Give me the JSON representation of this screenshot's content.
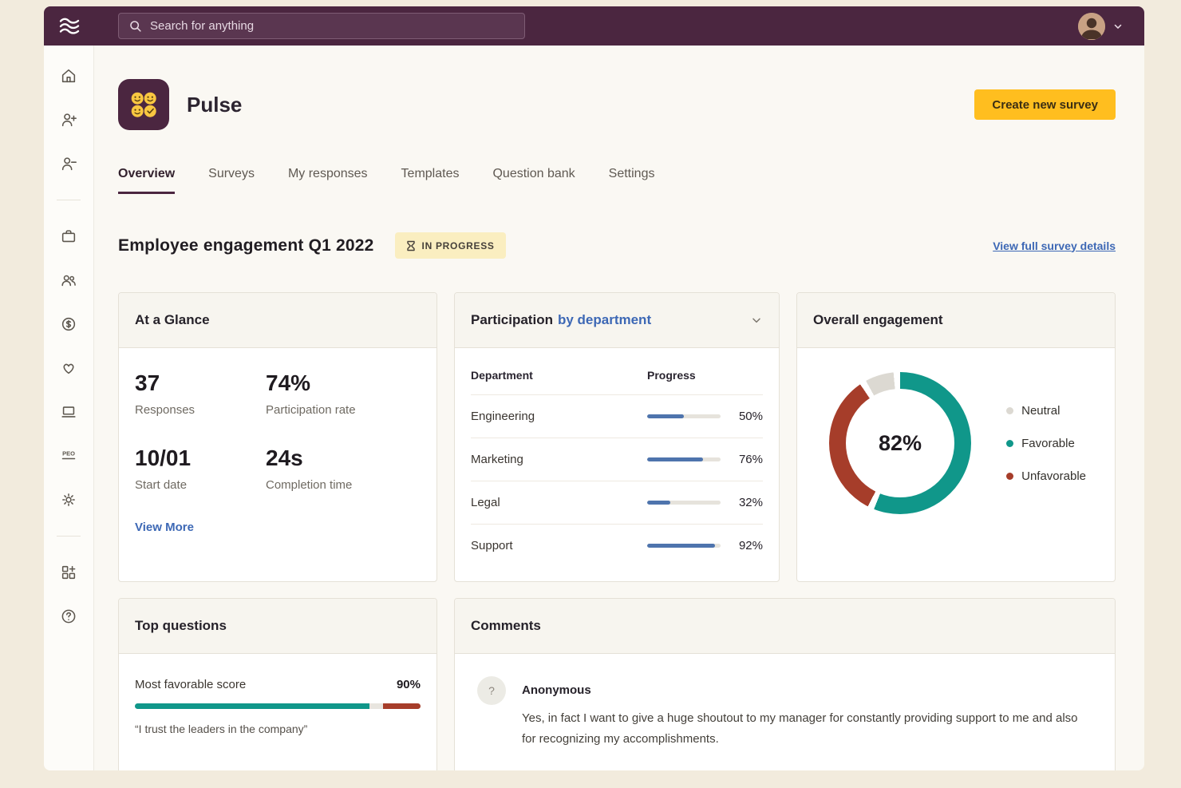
{
  "topbar": {
    "search_placeholder": "Search for anything"
  },
  "sidebar": {
    "peo_label": "PEO",
    "items": [
      {
        "icon": "home-icon"
      },
      {
        "icon": "add-user-icon"
      },
      {
        "icon": "remove-user-icon"
      },
      {
        "icon": "briefcase-icon"
      },
      {
        "icon": "team-icon"
      },
      {
        "icon": "payroll-dollar-icon"
      },
      {
        "icon": "benefits-heart-icon"
      },
      {
        "icon": "devices-laptop-icon"
      },
      {
        "icon": "peo-icon",
        "label": "PEO"
      },
      {
        "icon": "settings-gear-icon"
      },
      {
        "icon": "apps-grid-icon"
      },
      {
        "icon": "help-icon"
      }
    ]
  },
  "header": {
    "app_name": "Pulse",
    "create_button": "Create new survey"
  },
  "tabs": [
    {
      "label": "Overview",
      "active": true
    },
    {
      "label": "Surveys",
      "active": false
    },
    {
      "label": "My responses",
      "active": false
    },
    {
      "label": "Templates",
      "active": false
    },
    {
      "label": "Question bank",
      "active": false
    },
    {
      "label": "Settings",
      "active": false
    }
  ],
  "survey": {
    "title": "Employee engagement Q1 2022",
    "status_badge": "IN PROGRESS",
    "details_link": "View full survey details"
  },
  "glance": {
    "title": "At a Glance",
    "stats": [
      {
        "value": "37",
        "label": "Responses"
      },
      {
        "value": "74%",
        "label": "Participation rate"
      },
      {
        "value": "10/01",
        "label": "Start date"
      },
      {
        "value": "24s",
        "label": "Completion time"
      }
    ],
    "view_more": "View More"
  },
  "participation": {
    "title": "Participation",
    "title_accent": "by department",
    "col_department": "Department",
    "col_progress": "Progress",
    "rows": [
      {
        "department": "Engineering",
        "progress": 50,
        "label": "50%"
      },
      {
        "department": "Marketing",
        "progress": 76,
        "label": "76%"
      },
      {
        "department": "Legal",
        "progress": 32,
        "label": "32%"
      },
      {
        "department": "Support",
        "progress": 92,
        "label": "92%"
      }
    ]
  },
  "engagement": {
    "title": "Overall engagement",
    "score": "82%",
    "legend": [
      {
        "label": "Neutral",
        "color": "#dcd9d2"
      },
      {
        "label": "Favorable",
        "color": "#10978a"
      },
      {
        "label": "Unfavorable",
        "color": "#a63d2a"
      }
    ]
  },
  "top_questions": {
    "title": "Top questions",
    "metric_label": "Most favorable score",
    "metric_value": "90%",
    "quote": "“I trust the leaders in the company”"
  },
  "comments": {
    "title": "Comments",
    "avatar_glyph": "?",
    "items": [
      {
        "author": "Anonymous",
        "text": "Yes, in fact I want to give a huge shoutout to my manager for constantly providing support to me and also for recognizing my accomplishments."
      }
    ]
  },
  "chart_data": [
    {
      "type": "pie",
      "variant": "donut",
      "title": "Overall engagement",
      "center_label": "82%",
      "gap_percent": 1.5,
      "legend_position": "right",
      "segments": [
        {
          "name": "Favorable",
          "value": 57.5,
          "color": "#10978a"
        },
        {
          "name": "Unfavorable",
          "value": 34.5,
          "color": "#a63d2a"
        },
        {
          "name": "Neutral",
          "value": 8,
          "color": "#dcd9d2"
        }
      ]
    },
    {
      "type": "bar",
      "title": "Participation by department",
      "categories": [
        "Engineering",
        "Marketing",
        "Legal",
        "Support"
      ],
      "values": [
        50,
        76,
        32,
        92
      ],
      "unit": "%",
      "bar_color": "#4e74ad",
      "xlim": [
        0,
        100
      ]
    },
    {
      "type": "bar",
      "title": "Most favorable score",
      "label_value": "90%",
      "segments": [
        {
          "name": "favorable",
          "value": 82,
          "color": "#10978a"
        },
        {
          "name": "neutral",
          "value": 5,
          "color": "#e8e5df"
        },
        {
          "name": "unfavorable",
          "value": 13,
          "color": "#a63d2a"
        }
      ]
    }
  ],
  "colors": {
    "brand_plum": "#4b2640",
    "accent_yellow": "#ffbe1f",
    "link_blue": "#3d68b5",
    "teal": "#10978a",
    "rust": "#a63d2a"
  }
}
